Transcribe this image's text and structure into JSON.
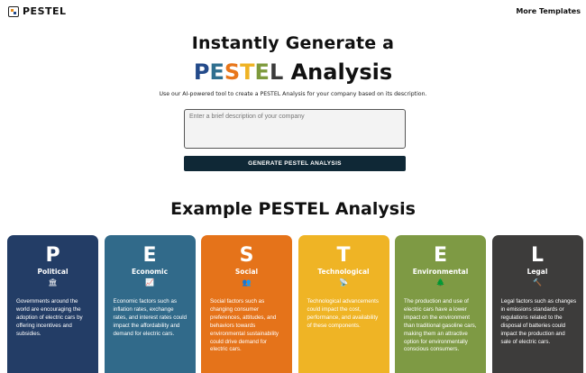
{
  "header": {
    "logo_text": "PESTEL",
    "more_templates": "More Templates"
  },
  "hero": {
    "line1": "Instantly Generate a",
    "pestel_letters": [
      {
        "char": "P",
        "color": "#234a8a"
      },
      {
        "char": "E",
        "color": "#2f6f8f"
      },
      {
        "char": "S",
        "color": "#e8761a"
      },
      {
        "char": "T",
        "color": "#efb324"
      },
      {
        "char": "E",
        "color": "#7e9a3c"
      },
      {
        "char": "L",
        "color": "#3b3b3b"
      }
    ],
    "line2_suffix": " Analysis",
    "subtitle": "Use our AI-powered tool to create a PESTEL Analysis for your company based on its description."
  },
  "form": {
    "placeholder": "Enter a brief description of your company",
    "value": "",
    "button_label": "GENERATE PESTEL ANALYSIS"
  },
  "example": {
    "title": "Example PESTEL Analysis",
    "cards": [
      {
        "letter": "P",
        "name": "Political",
        "icon": "bank-icon",
        "glyph": "🏛",
        "color": "#233d66",
        "desc": "Governments around the world are encouraging the adoption of electric cars by offering incentives and subsidies."
      },
      {
        "letter": "E",
        "name": "Economic",
        "icon": "trend-up-icon",
        "glyph": "📈",
        "color": "#316a8a",
        "desc": "Economic factors such as inflation rates, exchange rates, and interest rates could impact the affordability and demand for electric cars."
      },
      {
        "letter": "S",
        "name": "Social",
        "icon": "people-icon",
        "glyph": "👥",
        "color": "#e5731a",
        "desc": "Social factors such as changing consumer preferences, attitudes, and behaviors towards environmental sustainability could drive demand for electric cars."
      },
      {
        "letter": "T",
        "name": "Technological",
        "icon": "satellite-icon",
        "glyph": "📡",
        "color": "#efb425",
        "desc": "Technological advancements could impact the cost, performance, and availability of these components."
      },
      {
        "letter": "E",
        "name": "Environmental",
        "icon": "tree-icon",
        "glyph": "🌲",
        "color": "#7e9a44",
        "desc": "The production and use of electric cars have a lower impact on the environment than traditional gasoline cars, making them an attractive option for environmentally conscious consumers."
      },
      {
        "letter": "L",
        "name": "Legal",
        "icon": "gavel-icon",
        "glyph": "🔨",
        "color": "#3d3c3b",
        "desc": "Legal factors such as changes in emissions standards or regulations related to the disposal of batteries could impact the production and sale of electric cars."
      }
    ]
  }
}
